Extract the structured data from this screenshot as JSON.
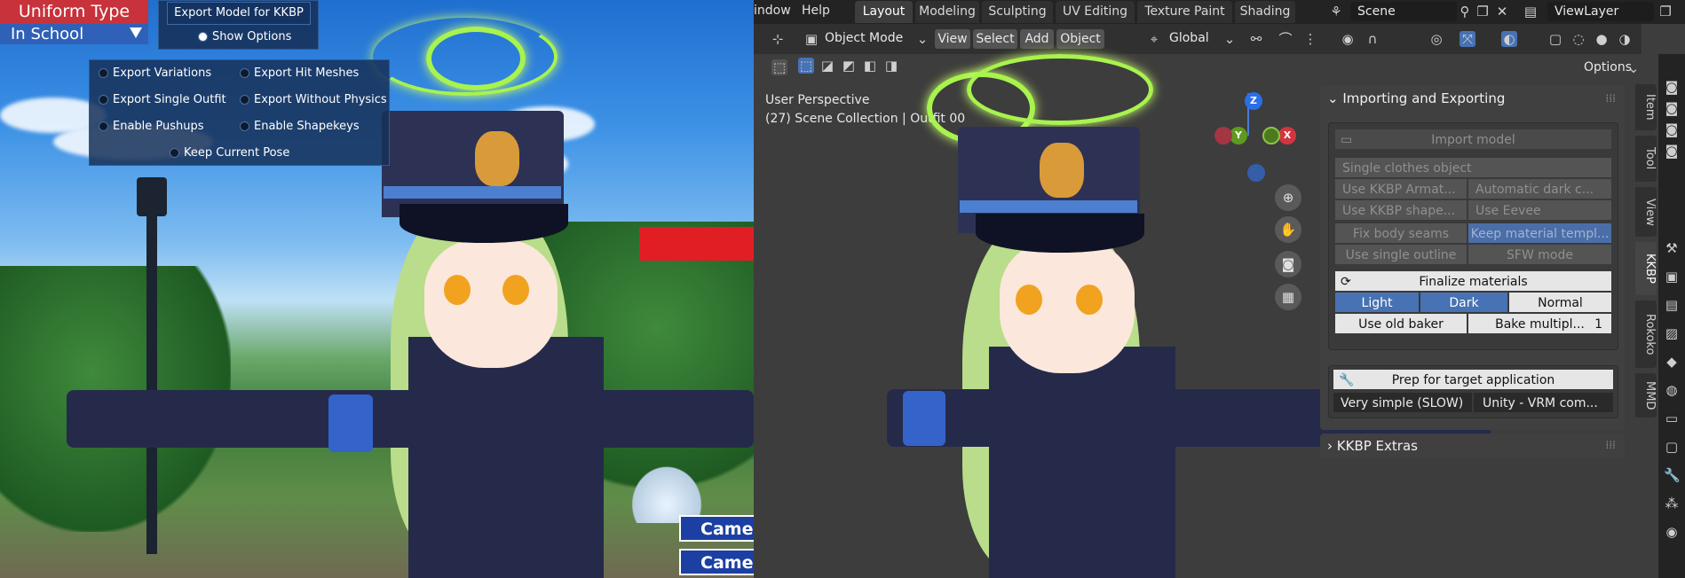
{
  "game": {
    "uniform_type_label": "Uniform Type",
    "uniform_value": "In School",
    "export_button": "Export Model for KKBP",
    "show_options": "Show Options",
    "options": [
      {
        "label": "Export Variations",
        "checked": false
      },
      {
        "label": "Export Hit Meshes",
        "checked": false
      },
      {
        "label": "Export Single Outfit",
        "checked": false
      },
      {
        "label": "Export Without Physics",
        "checked": false
      },
      {
        "label": "Enable Pushups",
        "checked": false
      },
      {
        "label": "Enable Shapekeys",
        "checked": false
      },
      {
        "label": "Keep Current Pose",
        "checked": false
      }
    ],
    "camera_buttons": [
      "Camer",
      "Camer"
    ]
  },
  "blender": {
    "menus": [
      "indow",
      "Help"
    ],
    "workspace_tabs": [
      "Layout",
      "Modeling",
      "Sculpting",
      "UV Editing",
      "Texture Paint",
      "Shading"
    ],
    "active_workspace": "Layout",
    "scene": "Scene",
    "view_layer": "ViewLayer",
    "header": {
      "mode": "Object Mode",
      "menus": [
        "View",
        "Select",
        "Add",
        "Object"
      ],
      "orientation": "Global",
      "options": "Options"
    },
    "viewport": {
      "perspective": "User Perspective",
      "collection": "(27) Scene Collection | Outfit 00"
    },
    "gizmo_axes": [
      "Z",
      "Y",
      "X"
    ],
    "panel": {
      "title": "Importing and Exporting",
      "import_model": "Import model",
      "single_clothes": "Single clothes object",
      "kkbp_armature": "Use KKBP Armat...",
      "auto_dark": "Automatic dark c...",
      "kkbp_shape": "Use KKBP shape...",
      "use_eevee": "Use Eevee",
      "fix_seams": "Fix body seams",
      "keep_material": "Keep material templ...",
      "single_outline": "Use single outline",
      "sfw_mode": "SFW mode",
      "finalize": "Finalize materials",
      "light": "Light",
      "dark": "Dark",
      "normal": "Normal",
      "old_baker": "Use old baker",
      "bake_mult_label": "Bake multipl...",
      "bake_mult_value": "1",
      "prep_title": "Prep for target application",
      "prep_quality": "Very simple (SLOW)",
      "prep_target": "Unity - VRM com...",
      "extras": "KKBP Extras"
    },
    "side_tabs": [
      "Item",
      "Tool",
      "View",
      "KKBP",
      "Rokoko",
      "MMD"
    ]
  }
}
